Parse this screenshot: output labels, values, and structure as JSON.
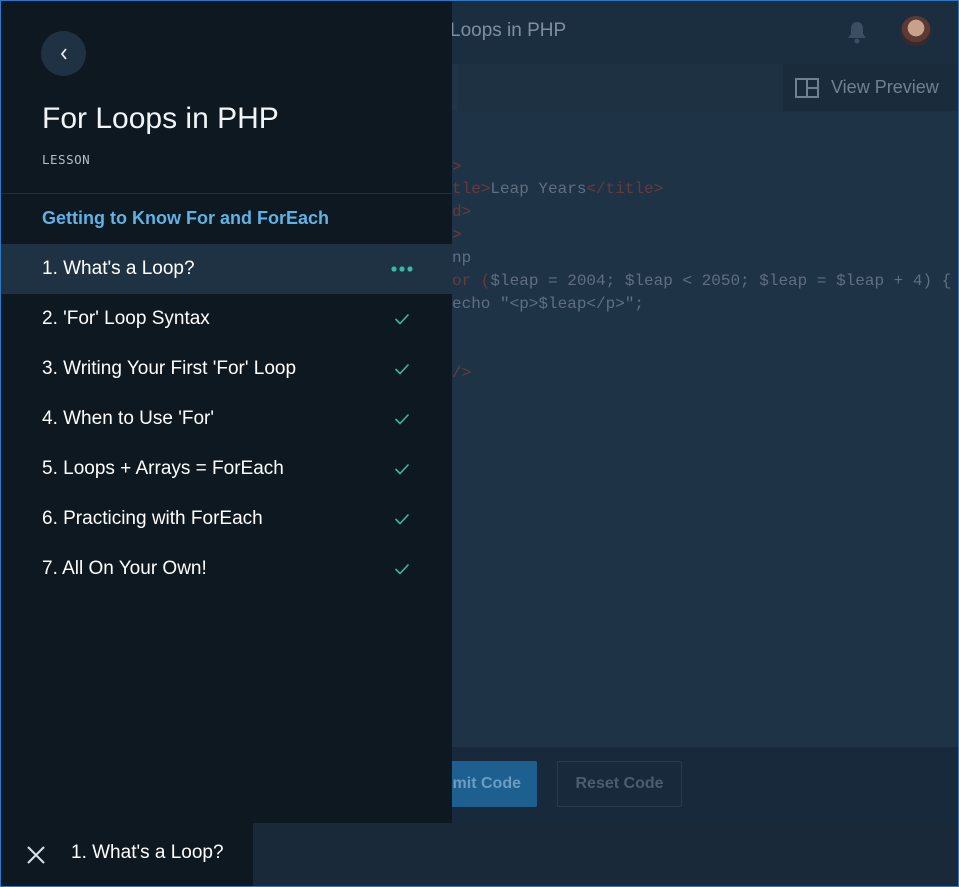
{
  "topbar": {
    "title": "Loops in PHP"
  },
  "toolbar": {
    "preview_label": "View Preview"
  },
  "editor": {
    "lines": [
      {
        "a": ">",
        "b": "",
        "c": ""
      },
      {
        "a": "tle>",
        "b": "Leap Years",
        "c": "</title>"
      },
      {
        "a": "d>",
        "b": "",
        "c": ""
      },
      {
        "a": ">",
        "b": "",
        "c": ""
      },
      {
        "a": "",
        "b": "np",
        "c": ""
      },
      {
        "a": "or (",
        "b": "$leap = 2004; $leap < 2050; $leap = $leap + 4) {",
        "c": ""
      },
      {
        "a": "",
        "b": "echo \"<p>$leap</p>\";",
        "c": ""
      },
      {
        "a": "/>",
        "b": "",
        "c": ""
      }
    ]
  },
  "actions": {
    "submit_label": "mit Code",
    "reset_label": "Reset Code"
  },
  "drawer": {
    "title": "For Loops in PHP",
    "tag": "LESSON",
    "section_title": "Getting to Know For and ForEach",
    "items": [
      {
        "label": "1. What's a Loop?",
        "status": "in-progress"
      },
      {
        "label": "2. 'For' Loop Syntax",
        "status": "complete"
      },
      {
        "label": "3. Writing Your First 'For' Loop",
        "status": "complete"
      },
      {
        "label": "4. When to Use 'For'",
        "status": "complete"
      },
      {
        "label": "5. Loops + Arrays = ForEach",
        "status": "complete"
      },
      {
        "label": "6. Practicing with ForEach",
        "status": "complete"
      },
      {
        "label": "7. All On Your Own!",
        "status": "complete"
      }
    ]
  },
  "footer": {
    "current_lesson": "1. What's a Loop?"
  },
  "colors": {
    "accent": "#5fb2e6",
    "check": "#39b9a4",
    "drawer_bg": "#0d1820",
    "active_row": "#1e3243"
  },
  "icons": {
    "back": "chevron-left-icon",
    "close": "close-icon",
    "check": "check-icon",
    "more": "more-dots-icon",
    "bell": "bell-icon",
    "preview": "layout-icon"
  }
}
